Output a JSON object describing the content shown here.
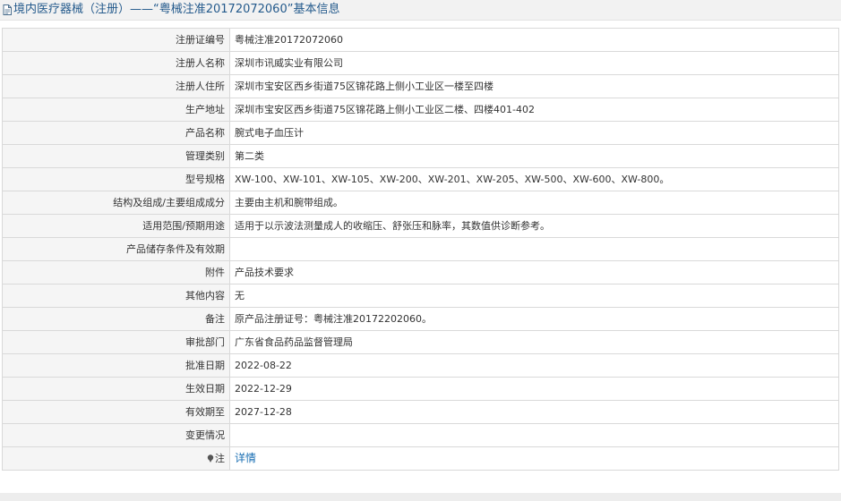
{
  "header": {
    "title": "境内医疗器械（注册）——“粤械注准20172072060”基本信息"
  },
  "rows": [
    {
      "label": "注册证编号",
      "value": "粤械注准20172072060"
    },
    {
      "label": "注册人名称",
      "value": "深圳市讯威实业有限公司"
    },
    {
      "label": "注册人住所",
      "value": "深圳市宝安区西乡街道75区锦花路上侧小工业区一楼至四楼"
    },
    {
      "label": "生产地址",
      "value": "深圳市宝安区西乡街道75区锦花路上侧小工业区二楼、四楼401-402"
    },
    {
      "label": "产品名称",
      "value": "腕式电子血压计"
    },
    {
      "label": "管理类别",
      "value": "第二类"
    },
    {
      "label": "型号规格",
      "value": "XW-100、XW-101、XW-105、XW-200、XW-201、XW-205、XW-500、XW-600、XW-800。"
    },
    {
      "label": "结构及组成/主要组成成分",
      "value": "主要由主机和腕带组成。"
    },
    {
      "label": "适用范围/预期用途",
      "value": "适用于以示波法测量成人的收缩压、舒张压和脉率，其数值供诊断参考。"
    },
    {
      "label": "产品储存条件及有效期",
      "value": ""
    },
    {
      "label": "附件",
      "value": "产品技术要求"
    },
    {
      "label": "其他内容",
      "value": "无"
    },
    {
      "label": "备注",
      "value": "原产品注册证号：粤械注准20172202060。"
    },
    {
      "label": "审批部门",
      "value": "广东省食品药品监督管理局"
    },
    {
      "label": "批准日期",
      "value": "2022-08-22"
    },
    {
      "label": "生效日期",
      "value": "2022-12-29"
    },
    {
      "label": "有效期至",
      "value": "2027-12-28"
    },
    {
      "label": "变更情况",
      "value": ""
    }
  ],
  "note": {
    "label": "注",
    "link_text": "详情"
  },
  "icons": {
    "title_icon": "document-icon",
    "note_icon": "pin-icon"
  },
  "colors": {
    "title_text": "#245a8c",
    "link": "#1a6fb3",
    "label_bg": "#f5f5f5",
    "border": "#d9d9d9"
  }
}
